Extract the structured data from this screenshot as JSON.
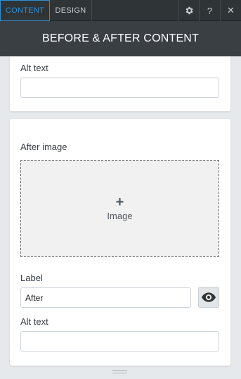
{
  "tabs": {
    "content": "CONTENT",
    "design": "DESIGN"
  },
  "toolbar": {
    "help_label": "?",
    "close_label": "✕"
  },
  "header": {
    "title": "BEFORE & AFTER CONTENT"
  },
  "top_section": {
    "alt_text_label": "Alt text",
    "alt_text_value": ""
  },
  "after_section": {
    "image_label": "After image",
    "dropzone_plus": "+",
    "dropzone_text": "Image",
    "label_label": "Label",
    "label_value": "After",
    "alt_text_label": "Alt text",
    "alt_text_value": ""
  },
  "colors": {
    "accent": "#2b8fd6",
    "topbar": "#2f3437",
    "header": "#393f43"
  },
  "icons": [
    "gear-icon",
    "help-icon",
    "close-icon",
    "eye-icon",
    "plus-icon",
    "resize-grip-icon"
  ]
}
